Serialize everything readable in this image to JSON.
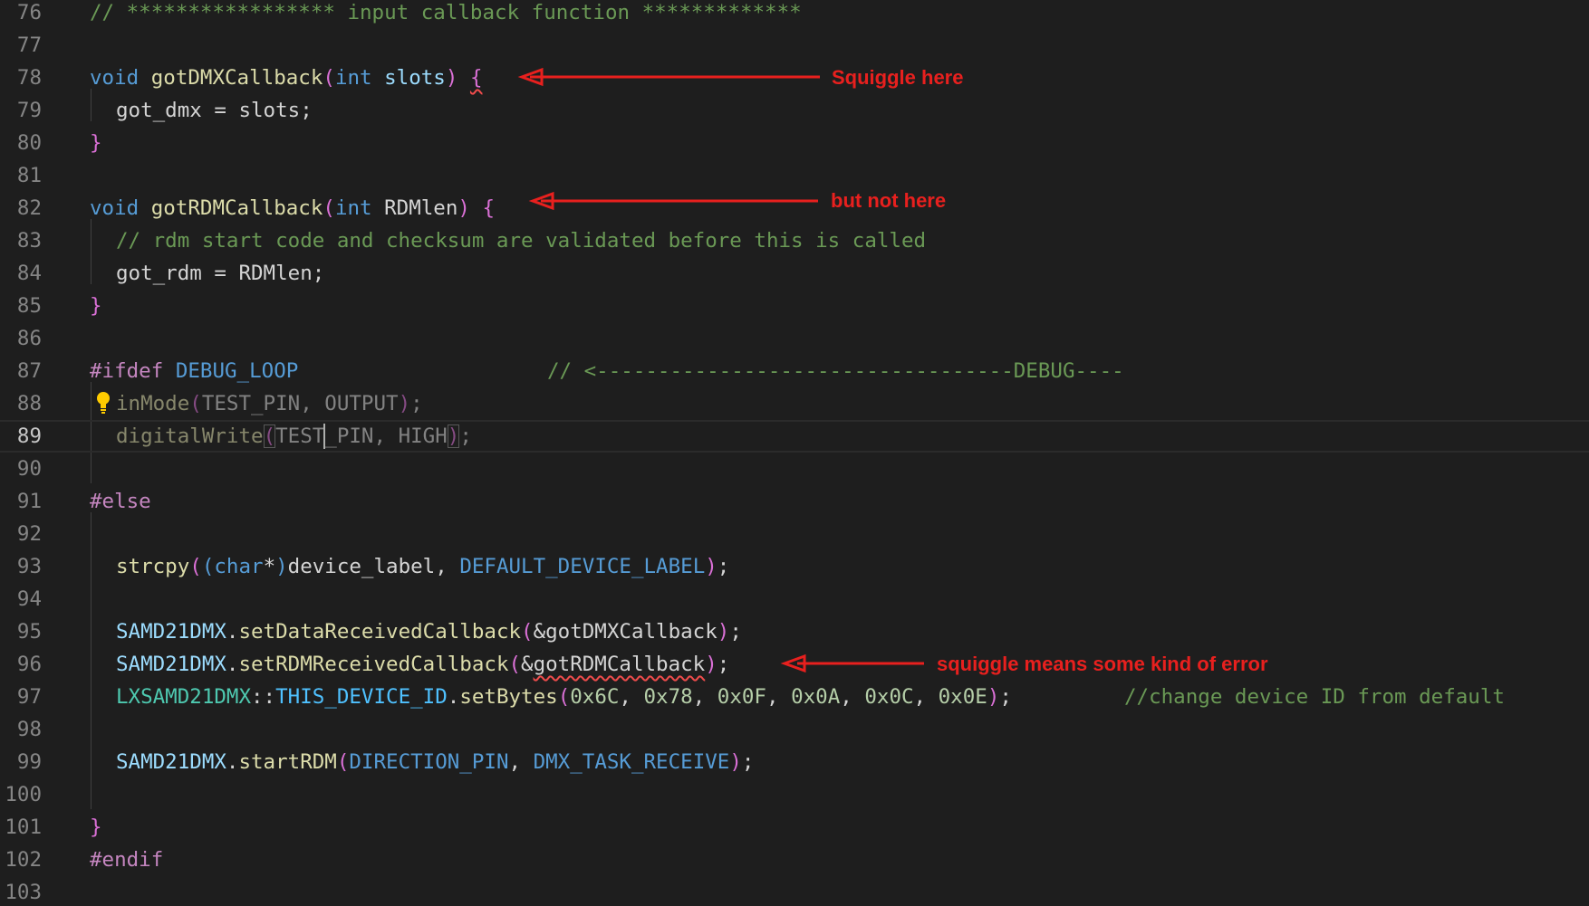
{
  "editor": {
    "colors": {
      "background": "#1e1e1e",
      "keyword": "#569cd6",
      "function": "#dcdcaa",
      "comment": "#6a9955",
      "preprocessor": "#c586c0",
      "annotation": "#e8201e",
      "error_squiggle": "#f14c4c"
    },
    "lines": {
      "l76": {
        "num": "76",
        "comment": "// ***************** input callback function *************"
      },
      "l77": {
        "num": "77"
      },
      "l78": {
        "num": "78",
        "kw": "void",
        "fn": "gotDMXCallback",
        "open": "(",
        "type": "int",
        "param": "slots",
        "close": ")",
        "brace": "{"
      },
      "l79": {
        "num": "79",
        "text": "got_dmx = slots;"
      },
      "l80": {
        "num": "80",
        "brace": "}"
      },
      "l81": {
        "num": "81"
      },
      "l82": {
        "num": "82",
        "kw": "void",
        "fn": "gotRDMCallback",
        "open": "(",
        "type": "int",
        "param": "RDMlen",
        "close": ")",
        "brace": "{"
      },
      "l83": {
        "num": "83",
        "comment": "// rdm start code and checksum are validated before this is called"
      },
      "l84": {
        "num": "84",
        "text": "got_rdm = RDMlen;"
      },
      "l85": {
        "num": "85",
        "brace": "}"
      },
      "l86": {
        "num": "86"
      },
      "l87": {
        "num": "87",
        "directive": "#ifdef",
        "macro": "DEBUG_LOOP",
        "comment": "// <----------------------------------DEBUG----"
      },
      "l88": {
        "num": "88",
        "fn": "inMode",
        "open": "(",
        "args": "TEST_PIN, OUTPUT",
        "close": ")",
        "end": ";"
      },
      "l89": {
        "num": "89",
        "fn": "digitalWrite",
        "open": "(",
        "args_a": "TES",
        "args_b": "T_PIN, HIGH",
        "close": ")",
        "end": ";"
      },
      "l90": {
        "num": "90"
      },
      "l91": {
        "num": "91",
        "directive": "#else"
      },
      "l92": {
        "num": "92"
      },
      "l93": {
        "num": "93",
        "fn": "strcpy",
        "open": "(",
        "open2": "(",
        "type": "char",
        "star": "*",
        "close2": ")",
        "var": "device_label, ",
        "macro": "DEFAULT_DEVICE_LABEL",
        "close": ")",
        "end": ";"
      },
      "l94": {
        "num": "94"
      },
      "l95": {
        "num": "95",
        "obj": "SAMD21DMX",
        "dot": ".",
        "fn": "setDataReceivedCallback",
        "open": "(",
        "arg": "&gotDMXCallback",
        "close": ")",
        "end": ";"
      },
      "l96": {
        "num": "96",
        "obj": "SAMD21DMX",
        "dot": ".",
        "fn": "setRDMReceivedCallback",
        "open": "(",
        "amp": "&",
        "arg": "gotRDMCallback",
        "close": ")",
        "end": ";"
      },
      "l97": {
        "num": "97",
        "cls": "LXSAMD21DMX",
        "scope": "::",
        "const": "THIS_DEVICE_ID",
        "dot": ".",
        "fn": "setBytes",
        "open": "(",
        "n1": "0x6C",
        "n2": "0x78",
        "n3": "0x0F",
        "n4": "0x0A",
        "n5": "0x0C",
        "n6": "0x0E",
        "sep": ", ",
        "close": ")",
        "end": ";",
        "comment": "//change device ID from default"
      },
      "l98": {
        "num": "98"
      },
      "l99": {
        "num": "99",
        "obj": "SAMD21DMX",
        "dot": ".",
        "fn": "startRDM",
        "open": "(",
        "c1": "DIRECTION_PIN",
        "sep": ", ",
        "c2": "DMX_TASK_RECEIVE",
        "close": ")",
        "end": ";"
      },
      "l100": {
        "num": "100"
      },
      "l101": {
        "num": "101",
        "brace": "}"
      },
      "l102": {
        "num": "102",
        "directive": "#endif"
      },
      "l103": {
        "num": "103"
      }
    }
  },
  "annotations": {
    "a1": "Squiggle here",
    "a2": "but not here",
    "a3": "squiggle means some kind of error"
  },
  "icons": {
    "bulb": "lightbulb-icon"
  }
}
